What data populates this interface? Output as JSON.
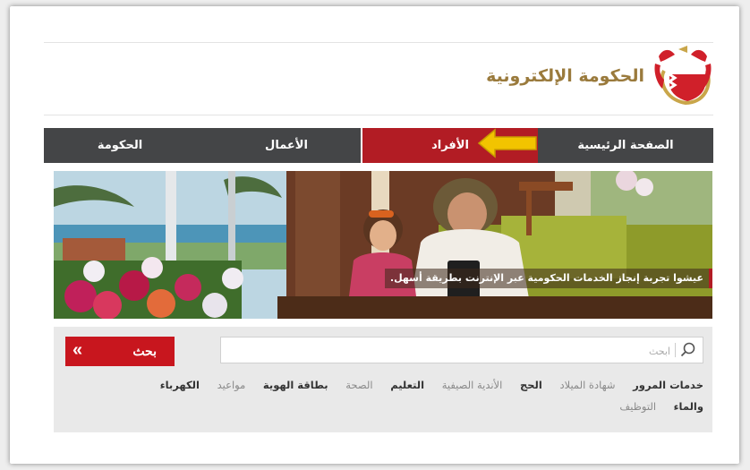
{
  "header": {
    "logo_text": "الحكومة الإلكترونية"
  },
  "nav": {
    "items": [
      {
        "label": "الصفحة الرئيسية"
      },
      {
        "label": "الأفراد"
      },
      {
        "label": "الأعمال"
      },
      {
        "label": "الحكومة"
      }
    ],
    "active": "الأفراد"
  },
  "hero": {
    "caption": "عيشوا تجربة إنجاز الخدمات الحكومية عبر الإنترنت بطريقة أسهل."
  },
  "search": {
    "placeholder": "ابحث",
    "button_label": "بحث",
    "button_chevron": "«"
  },
  "quick_links": {
    "row1": [
      {
        "label": "خدمات المرور",
        "style": "bold"
      },
      {
        "label": "شهادة الميلاد",
        "style": "light"
      },
      {
        "label": "الحج",
        "style": "bold"
      },
      {
        "label": "الأندية الصيفية",
        "style": "light"
      },
      {
        "label": "التعليم",
        "style": "bold"
      },
      {
        "label": "الصحة",
        "style": "light"
      },
      {
        "label": "بطاقة الهوية",
        "style": "bold"
      },
      {
        "label": "مواعيد",
        "style": "light"
      },
      {
        "label": "الكهرباء",
        "style": "bold"
      }
    ],
    "row2": [
      {
        "label": "والماء",
        "style": "bold"
      },
      {
        "label": "التوظيف",
        "style": "light"
      }
    ]
  },
  "colors": {
    "nav_bg": "#444547",
    "nav_active": "#b21c24",
    "arrow": "#f2c400",
    "logo_text": "#9a7a3c",
    "search_button": "#c8161e"
  }
}
